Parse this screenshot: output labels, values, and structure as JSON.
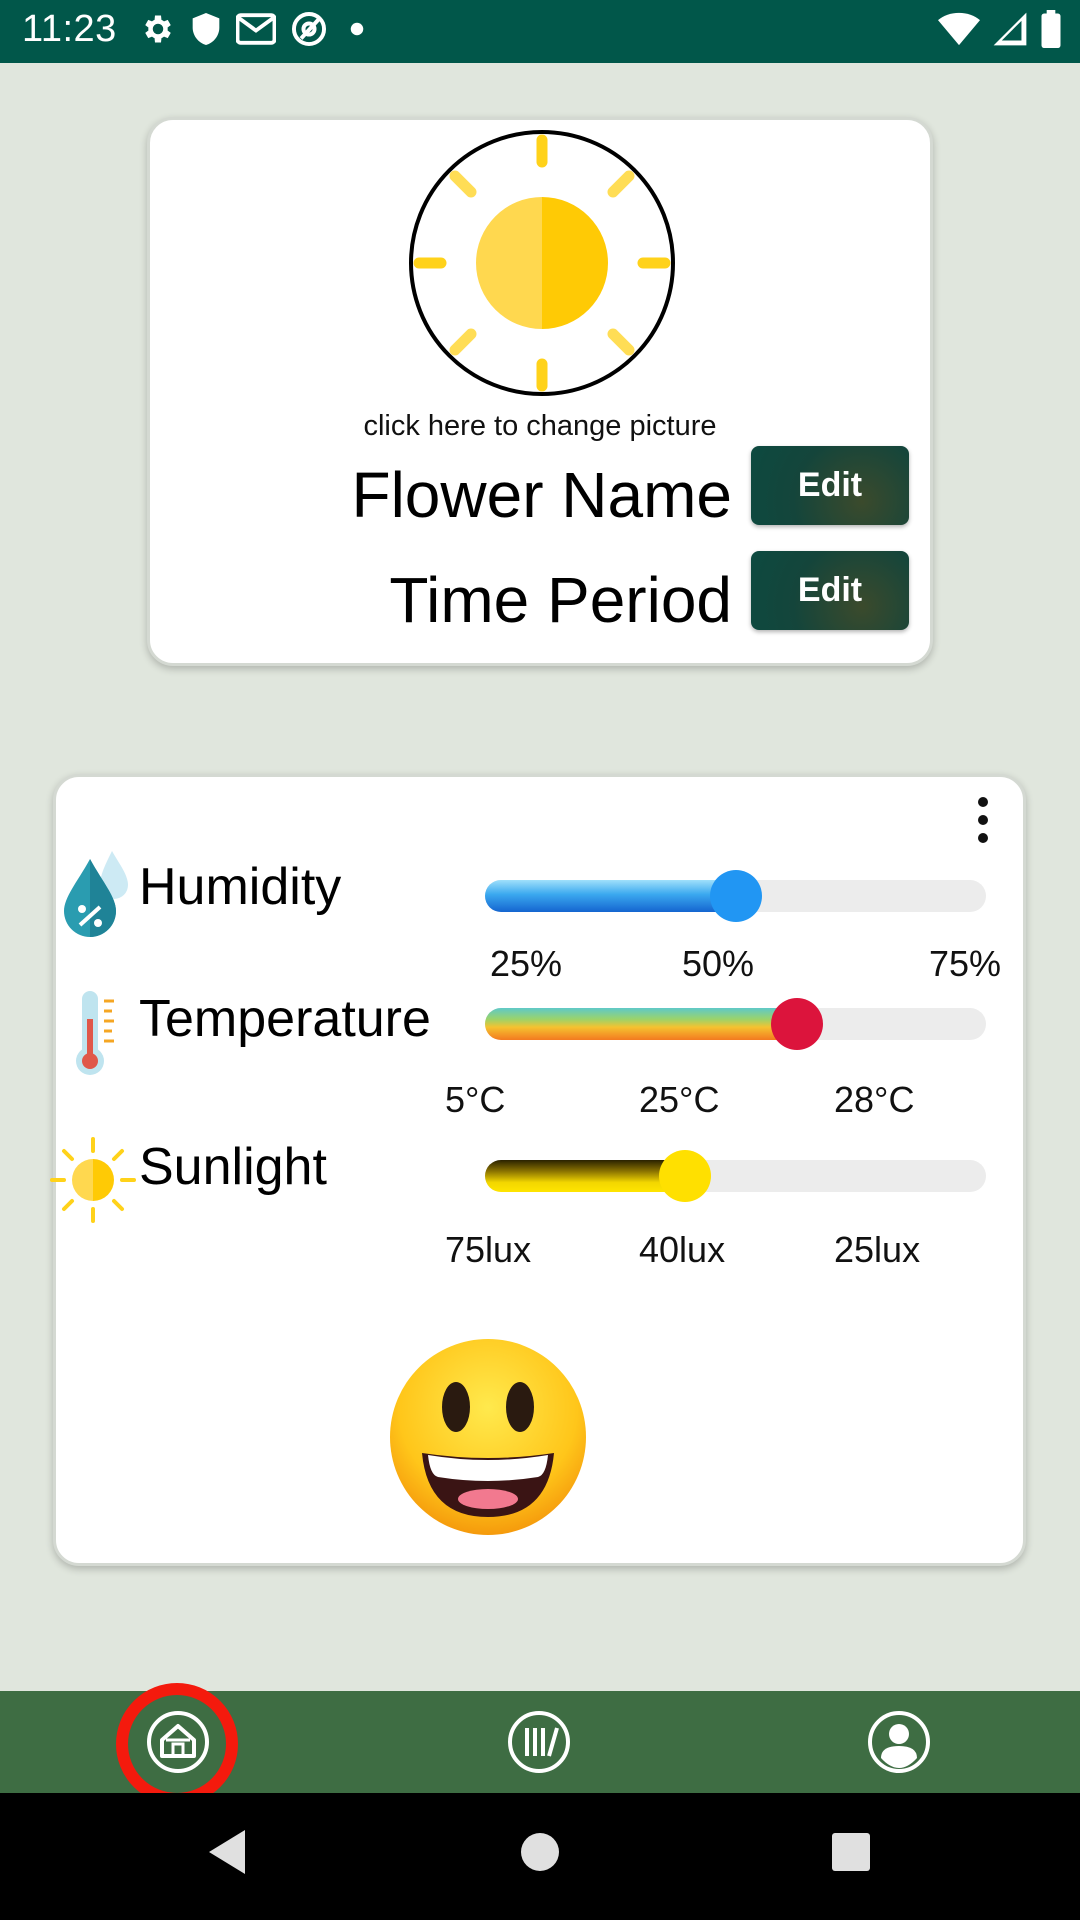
{
  "status_bar": {
    "time": "11:23",
    "left_icons": [
      "gear-icon",
      "shield-icon",
      "gmail-icon",
      "at-sign-icon",
      "dot-icon"
    ],
    "right_icons": [
      "wifi-icon",
      "signal-icon",
      "battery-icon"
    ],
    "background": "#01574a"
  },
  "profile_card": {
    "picture_icon": "sun-icon",
    "change_picture_hint": "click here to change picture",
    "flower_name": "Flower Name",
    "time_period": "Time Period",
    "edit_name_label": "Edit",
    "edit_period_label": "Edit"
  },
  "sensor_card": {
    "menu_icon": "more-vertical-icon",
    "sensors": [
      {
        "label": "Humidity",
        "icon": "humidity-drop-icon",
        "ticks": [
          "25%",
          "50%",
          "75%"
        ],
        "current_fraction": 0.5,
        "colors": [
          "#1565d0",
          "#2196f3"
        ]
      },
      {
        "label": "Temperature",
        "icon": "thermometer-icon",
        "ticks": [
          "5°C",
          "25°C",
          "28°C"
        ],
        "current_fraction": 0.62,
        "colors": [
          "#f37a20",
          "#dc143c"
        ]
      },
      {
        "label": "Sunlight",
        "icon": "sun-small-icon",
        "ticks": [
          "75lux",
          "40lux",
          "25lux"
        ],
        "current_fraction": 0.4,
        "colors": [
          "#f2d600",
          "#ffe000"
        ]
      }
    ],
    "mood_icon": "smiling-face-icon"
  },
  "bottom_nav": {
    "items": [
      {
        "icon": "home-icon",
        "selected": true
      },
      {
        "icon": "history-icon",
        "selected": false
      },
      {
        "icon": "profile-icon",
        "selected": false
      }
    ],
    "background": "#3e6d43",
    "highlight_color": "#f41a0d"
  },
  "system_nav": {
    "buttons": [
      "back-icon",
      "home-circle-icon",
      "recents-icon"
    ]
  }
}
